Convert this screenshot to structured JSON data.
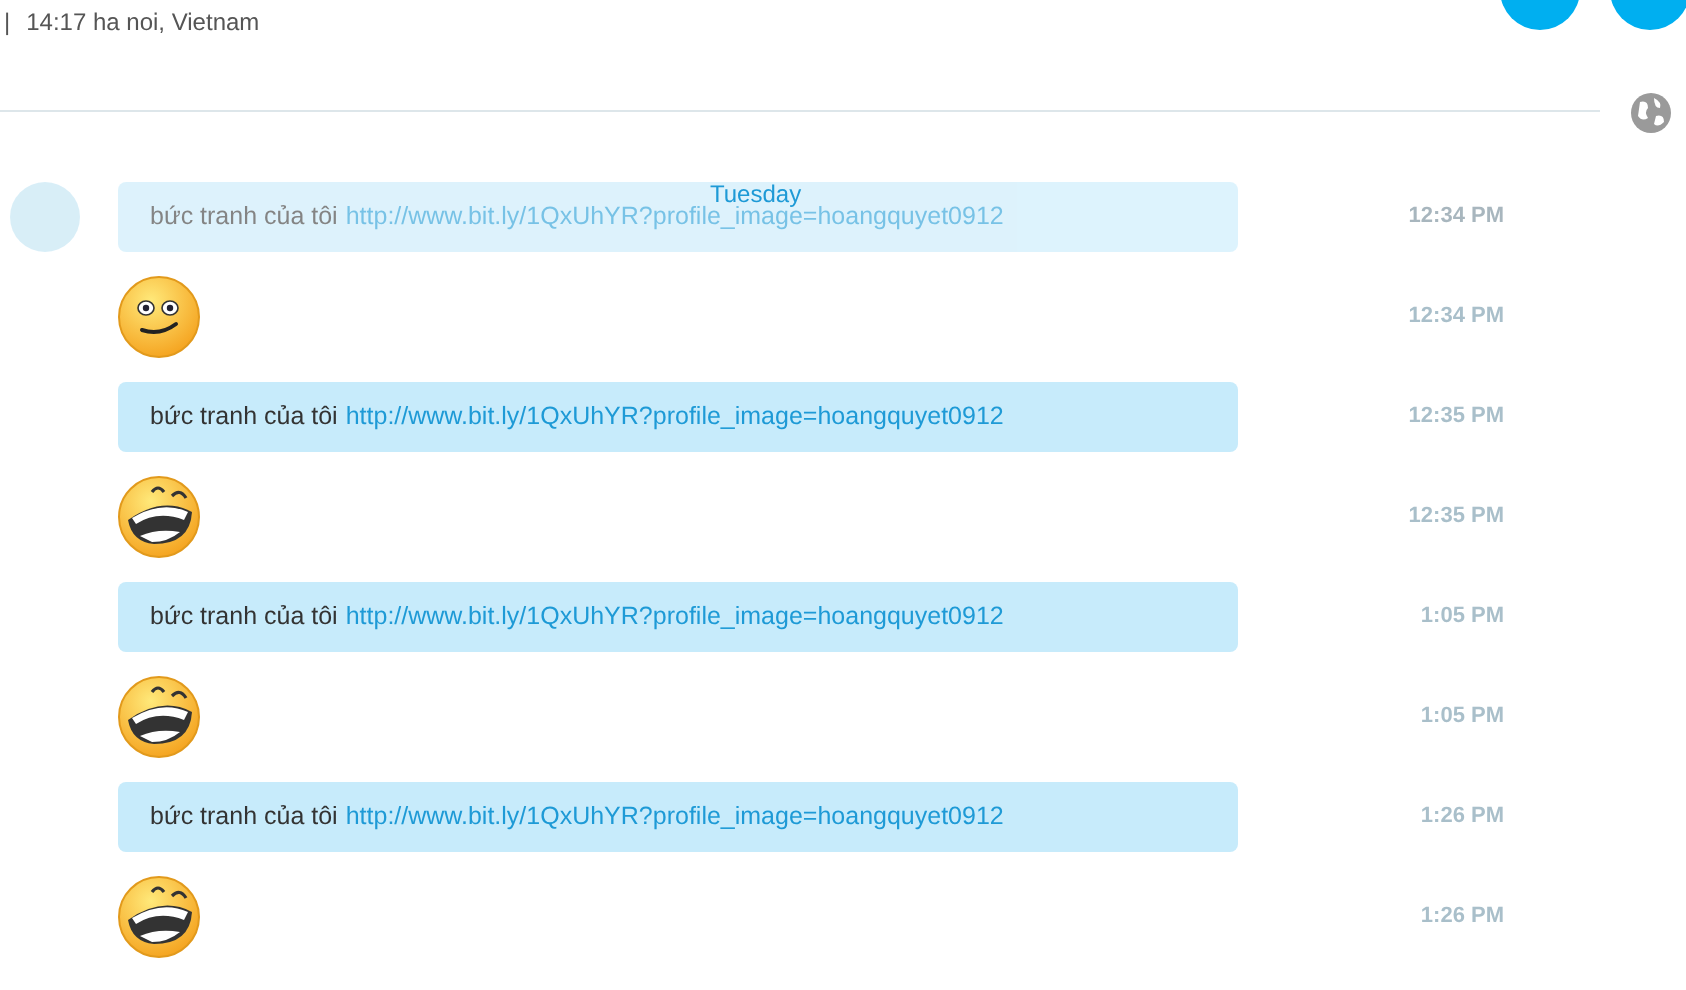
{
  "header": {
    "separator": "|",
    "status": "14:17 ha noi, Vietnam"
  },
  "day_label": "Tuesday",
  "messages": [
    {
      "kind": "text",
      "faded": true,
      "text": "bức tranh của tôi",
      "link": "http://www.bit.ly/1QxUhYR?profile_image=hoangquyet0912",
      "time": "12:34 PM"
    },
    {
      "kind": "smiley",
      "time": "12:34 PM"
    },
    {
      "kind": "text",
      "faded": false,
      "text": "bức tranh của tôi",
      "link": "http://www.bit.ly/1QxUhYR?profile_image=hoangquyet0912",
      "time": "12:35 PM"
    },
    {
      "kind": "laughing",
      "time": "12:35 PM"
    },
    {
      "kind": "text",
      "faded": false,
      "text": "bức tranh của tôi",
      "link": "http://www.bit.ly/1QxUhYR?profile_image=hoangquyet0912",
      "time": "1:05 PM"
    },
    {
      "kind": "laughing",
      "time": "1:05 PM"
    },
    {
      "kind": "text",
      "faded": false,
      "text": "bức tranh của tôi",
      "link": "http://www.bit.ly/1QxUhYR?profile_image=hoangquyet0912",
      "time": "1:26 PM"
    },
    {
      "kind": "laughing",
      "time": "1:26 PM"
    }
  ]
}
